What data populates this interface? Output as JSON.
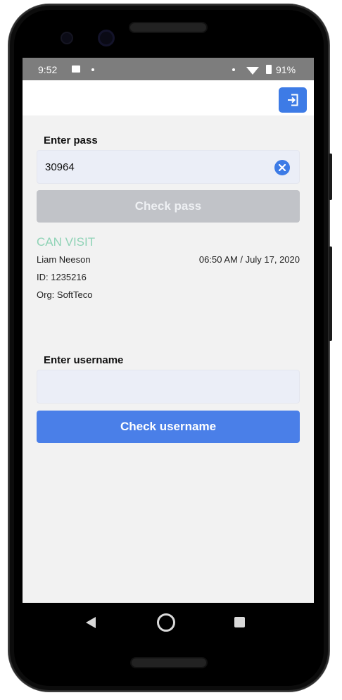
{
  "status_bar": {
    "time": "9:52",
    "battery": "91%"
  },
  "app_bar": {
    "logout_icon": "logout-icon"
  },
  "pass_section": {
    "label": "Enter pass",
    "value": "30964",
    "clear_icon": "clear-circle-icon",
    "button_label": "Check pass"
  },
  "result": {
    "status": "CAN VISIT",
    "status_color": "#8fd3b6",
    "name": "Liam Neeson",
    "datetime": "06:50 AM / July 17, 2020",
    "id": "ID: 1235216",
    "org": "Org: SoftTeco"
  },
  "username_section": {
    "label": "Enter username",
    "value": "",
    "button_label": "Check username"
  },
  "colors": {
    "accent": "#3d7be6",
    "disabled_button": "#c1c3c8",
    "input_bg": "#ebeef7"
  },
  "nav_bar": {
    "back_icon": "back-triangle-icon",
    "home_icon": "home-circle-icon",
    "recents_icon": "recents-square-icon"
  }
}
